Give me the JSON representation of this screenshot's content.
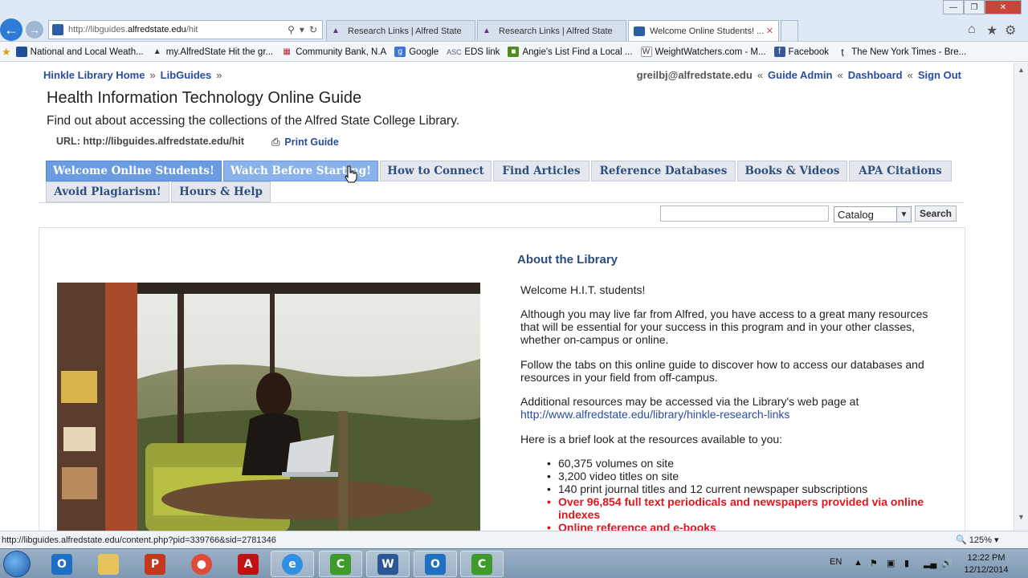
{
  "browser": {
    "address_url": "http://libguides.alfredstate.edu/hit",
    "address_url_prefix": "http://libguides.",
    "address_url_domain": "alfredstate.edu",
    "address_url_suffix": "/hit",
    "tabs": [
      {
        "label": "Research Links | Alfred State",
        "active": false
      },
      {
        "label": "Research Links | Alfred State",
        "active": false
      },
      {
        "label": "Welcome Online Students! ...",
        "active": true
      }
    ],
    "favorites": [
      "National and Local Weath...",
      "my.AlfredState  Hit the gr...",
      "Community Bank, N.A",
      "Google",
      "EDS link",
      "Angie's List  Find a Local ...",
      "WeightWatchers.com - M...",
      "Facebook",
      "The New York Times - Bre..."
    ],
    "status_url": "http://libguides.alfredstate.edu/content.php?pid=339766&sid=2781346",
    "zoom": "125%"
  },
  "header": {
    "crumb_home": "Hinkle Library Home",
    "crumb_libguides": "LibGuides",
    "crumb_sep": "»",
    "user_email": "greilbj@alfredstate.edu",
    "user_sep": "«",
    "guide_admin": "Guide Admin",
    "dashboard": "Dashboard",
    "sign_out": "Sign Out"
  },
  "guide": {
    "title": "Health Information Technology Online Guide",
    "description": "Find out about accessing the collections of the Alfred State College Library.",
    "url_label": "URL: http://libguides.alfredstate.edu/hit",
    "print_label": "Print Guide"
  },
  "guide_tabs": [
    "Welcome Online Students!",
    "Watch Before Starting!",
    "How to Connect",
    "Find Articles",
    "Reference Databases",
    "Books & Videos",
    "APA Citations",
    "Avoid Plagiarism!",
    "Hours & Help"
  ],
  "search": {
    "query": "",
    "source": "Catalog",
    "button": "Search"
  },
  "about": {
    "title": "About the Library",
    "welcome": "Welcome H.I.T. students!",
    "distance": "Although you may live far from Alfred, you have access to a great many resources that will be essential for your success in this program and in your other classes, whether on-campus or online.",
    "tabs_note": "Follow the tabs on this online guide to discover how to access our databases and resources in your field from off-campus.",
    "additional": "Additional resources may be accessed via the Library's web page at",
    "link": "http://www.alfredstate.edu/library/hinkle-research-links",
    "brief": "Here is a brief look at the resources available to you:",
    "resources": [
      {
        "text": "60,375 volumes on site",
        "highlight": false
      },
      {
        "text": "3,200 video titles on site",
        "highlight": false
      },
      {
        "text": "140 print journal titles and 12 current newspaper subscriptions",
        "highlight": false
      },
      {
        "text": "Over 96,854 full text periodicals and newspapers provided via online indexes",
        "highlight": true
      },
      {
        "text": "Online reference and e-books",
        "highlight": true
      }
    ]
  },
  "taskbar": {
    "language": "EN",
    "time": "12:22 PM",
    "date": "12/12/2014"
  }
}
